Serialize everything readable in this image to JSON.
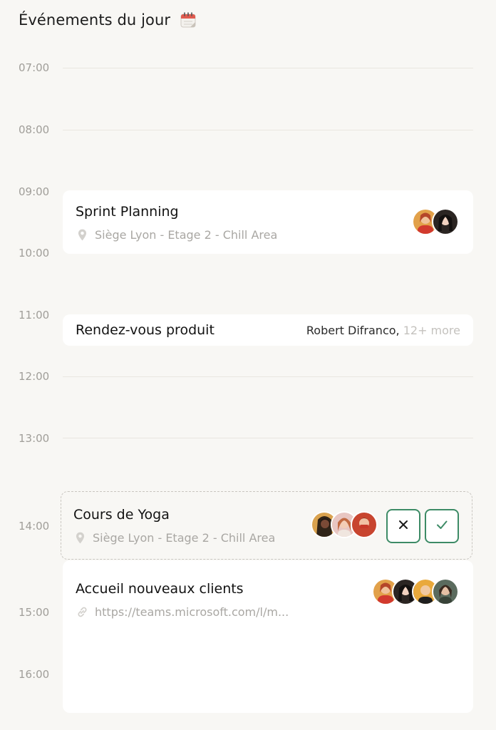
{
  "header": {
    "title": "Événements du jour",
    "icon": "calendar-icon"
  },
  "hours": [
    "07:00",
    "08:00",
    "09:00",
    "10:00",
    "11:00",
    "12:00",
    "13:00",
    "14:00",
    "15:00",
    "16:00"
  ],
  "events": {
    "sprint": {
      "name": "Sprint Planning",
      "location": "Siège Lyon - Etage 2 - Chill Area",
      "location_icon": "location-pin-icon",
      "attendee_count": 2
    },
    "rdv": {
      "name": "Rendez-vous produit",
      "person": "Robert Difranco,",
      "more": "12+ more"
    },
    "yoga": {
      "name": "Cours de Yoga",
      "location": "Siège Lyon - Etage 2 - Chill Area",
      "location_icon": "location-pin-icon",
      "attendee_count": 3,
      "decline_icon": "close-icon",
      "accept_icon": "check-icon"
    },
    "accueil": {
      "name": "Accueil nouveaux clients",
      "link": "https://teams.microsoft.com/l/m...",
      "link_icon": "link-icon",
      "attendee_count": 4
    }
  },
  "colors": {
    "background": "#f8f7f4",
    "card": "#ffffff",
    "accent_green": "#3d8b66",
    "muted_text": "#a9a7a3"
  }
}
